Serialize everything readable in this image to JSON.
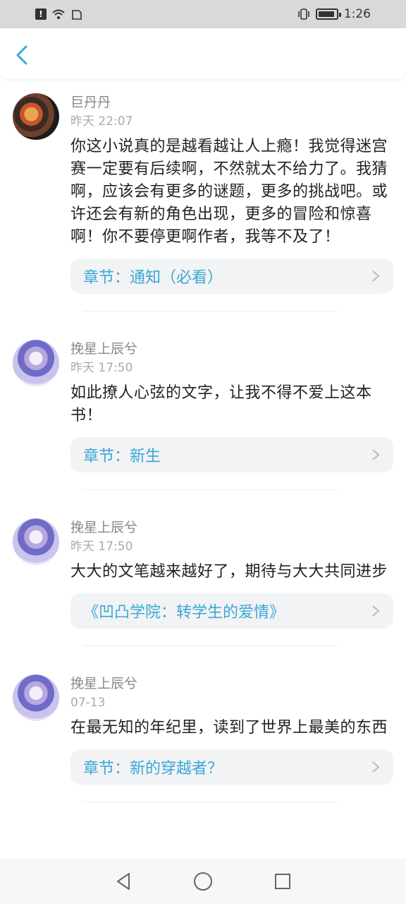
{
  "status_bar": {
    "time": "1:26"
  },
  "header": {
    "back_icon": "chevron-left-icon"
  },
  "comments": [
    {
      "username": "巨丹丹",
      "time": "昨天 22:07",
      "text": "你这小说真的是越看越让人上瘾！我觉得迷宫赛一定要有后续啊，不然就太不给力了。我猜啊，应该会有更多的谜题，更多的挑战吧。或许还会有新的角色出现，更多的冒险和惊喜啊！你不要停更啊作者，我等不及了！",
      "chapter": "章节：通知（必看）",
      "avatar": "food-avatar"
    },
    {
      "username": "挽星上辰兮",
      "time": "昨天 17:50",
      "text": "如此撩人心弦的文字，让我不得不爱上这本书！",
      "chapter": "章节：新生",
      "avatar": "girl-avatar"
    },
    {
      "username": "挽星上辰兮",
      "time": "昨天 17:50",
      "text": "大大的文笔越来越好了，期待与大大共同进步",
      "chapter": "《凹凸学院：转学生的爱情》",
      "avatar": "girl-avatar"
    },
    {
      "username": "挽星上辰兮",
      "time": "07-13",
      "text": "在最无知的年纪里，读到了世界上最美的东西",
      "chapter": "章节：新的穿越者？",
      "avatar": "girl-avatar"
    }
  ],
  "nav_bar": {
    "back": "back-triangle-icon",
    "home": "home-circle-icon",
    "recents": "recents-square-icon"
  },
  "colors": {
    "accent": "#3aa7d6",
    "status_bar": "#d9d9d9"
  }
}
